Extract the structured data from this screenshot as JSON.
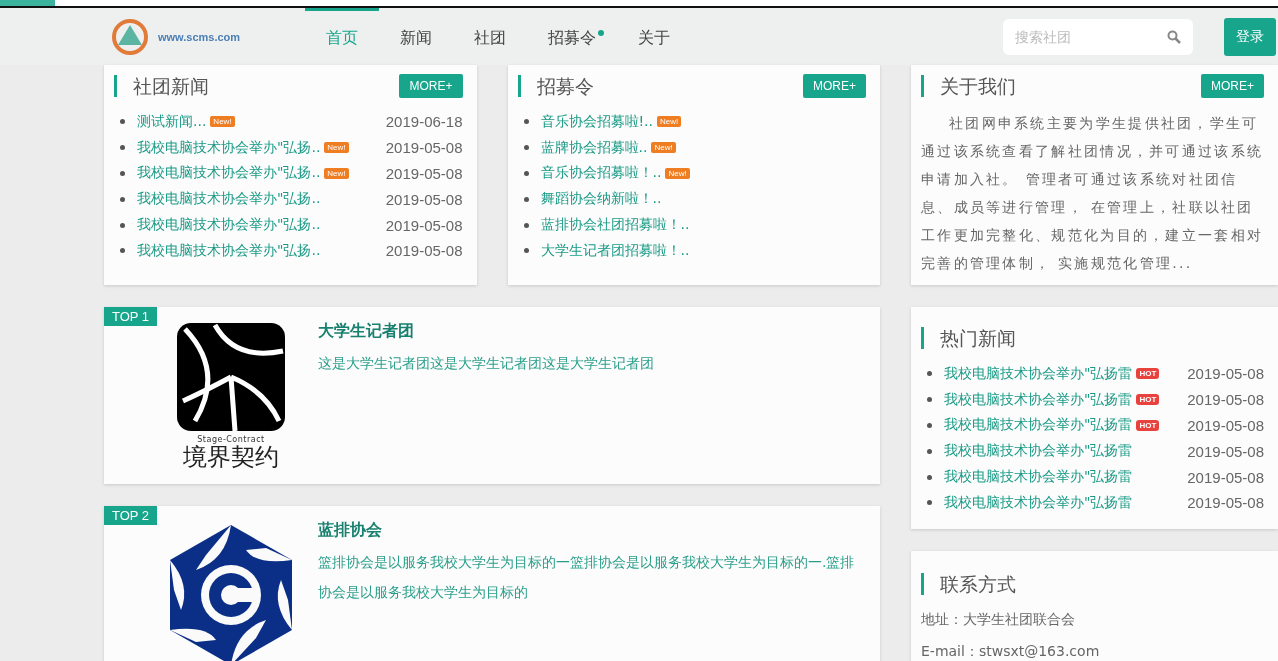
{
  "logo": {
    "text": "www.scms.com"
  },
  "nav": [
    {
      "label": "首页",
      "selected": true,
      "dot": false
    },
    {
      "label": "新闻",
      "selected": false,
      "dot": false
    },
    {
      "label": "社团",
      "selected": false,
      "dot": false
    },
    {
      "label": "招募令",
      "selected": false,
      "dot": true
    },
    {
      "label": "关于",
      "selected": false,
      "dot": false
    }
  ],
  "search": {
    "placeholder": "搜索社团"
  },
  "login": "登录",
  "news": {
    "title": "社团新闻",
    "more": "MORE+",
    "items": [
      {
        "title": "测试新闻...",
        "badge": "New!",
        "date": "2019-06-18"
      },
      {
        "title": "我校电脑技术协会举办\"弘扬..",
        "badge": "New!",
        "date": "2019-05-08"
      },
      {
        "title": "我校电脑技术协会举办\"弘扬..",
        "badge": "New!",
        "date": "2019-05-08"
      },
      {
        "title": "我校电脑技术协会举办\"弘扬..",
        "date": "2019-05-08"
      },
      {
        "title": "我校电脑技术协会举办\"弘扬..",
        "date": "2019-05-08"
      },
      {
        "title": "我校电脑技术协会举办\"弘扬..",
        "date": "2019-05-08"
      }
    ]
  },
  "recruit": {
    "title": "招募令",
    "more": "MORE+",
    "items": [
      {
        "title": "音乐协会招募啦!..",
        "badge": "New!"
      },
      {
        "title": "蓝牌协会招募啦..",
        "badge": "New!"
      },
      {
        "title": "音乐协会招募啦！..",
        "badge": "New!"
      },
      {
        "title": "舞蹈协会纳新啦！.."
      },
      {
        "title": "蓝排协会社团招募啦！.."
      },
      {
        "title": "大学生记者团招募啦！.."
      }
    ]
  },
  "top": [
    {
      "rank": "TOP 1",
      "kind": "stage",
      "logo_text": "境界契约",
      "logo_sub": "Stage-Contract",
      "name": "大学生记者团",
      "desc": "这是大学生记者团这是大学生记者团这是大学生记者团"
    },
    {
      "rank": "TOP 2",
      "kind": "swirl",
      "name": "蓝排协会",
      "desc": "篮排协会是以服务我校大学生为目标的一篮排协会是以服务我校大学生为目标的一.篮排协会是以服务我校大学生为目标的"
    }
  ],
  "about": {
    "title": "关于我们",
    "more": "MORE+",
    "text": "社团网申系统主要为学生提供社团，学生可通过该系统查看了解社团情况，并可通过该系统申请加入社。 管理者可通过该系统对社团信息、成员等进行管理， 在管理上，社联以社团工作更加完整化、规范化为目的，建立一套相对完善的管理体制， 实施规范化管理..."
  },
  "hot": {
    "title": "热门新闻",
    "items": [
      {
        "title": "我校电脑技术协会举办\"弘扬雷",
        "badge": "HOT",
        "date": "2019-05-08"
      },
      {
        "title": "我校电脑技术协会举办\"弘扬雷",
        "badge": "HOT",
        "date": "2019-05-08"
      },
      {
        "title": "我校电脑技术协会举办\"弘扬雷",
        "badge": "HOT",
        "date": "2019-05-08"
      },
      {
        "title": "我校电脑技术协会举办\"弘扬雷",
        "date": "2019-05-08"
      },
      {
        "title": "我校电脑技术协会举办\"弘扬雷",
        "date": "2019-05-08"
      },
      {
        "title": "我校电脑技术协会举办\"弘扬雷",
        "date": "2019-05-08"
      }
    ]
  },
  "contact": {
    "title": "联系方式",
    "lines": [
      "地址：大学生社团联合会",
      "E-mail：stwsxt@163.com"
    ]
  }
}
